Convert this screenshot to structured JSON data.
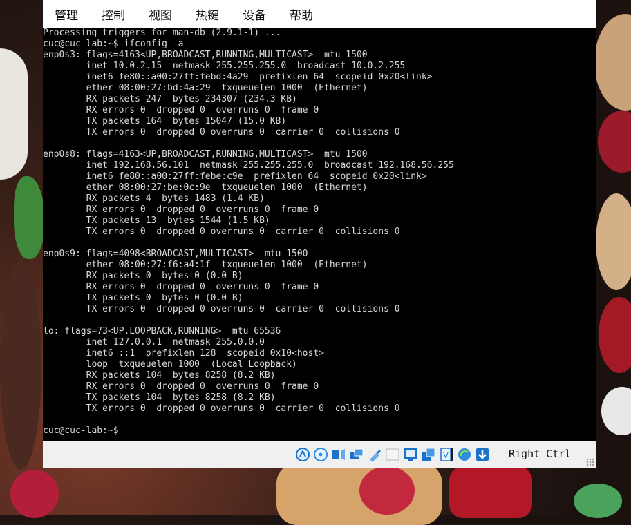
{
  "menubar": {
    "items": [
      "管理",
      "控制",
      "视图",
      "热键",
      "设备",
      "帮助"
    ]
  },
  "terminal": {
    "lines": [
      "Processing triggers for man-db (2.9.1-1) ...",
      "cuc@cuc-lab:~$ ifconfig -a",
      "enp0s3: flags=4163<UP,BROADCAST,RUNNING,MULTICAST>  mtu 1500",
      "        inet 10.0.2.15  netmask 255.255.255.0  broadcast 10.0.2.255",
      "        inet6 fe80::a00:27ff:febd:4a29  prefixlen 64  scopeid 0x20<link>",
      "        ether 08:00:27:bd:4a:29  txqueuelen 1000  (Ethernet)",
      "        RX packets 247  bytes 234307 (234.3 KB)",
      "        RX errors 0  dropped 0  overruns 0  frame 0",
      "        TX packets 164  bytes 15047 (15.0 KB)",
      "        TX errors 0  dropped 0 overruns 0  carrier 0  collisions 0",
      "",
      "enp0s8: flags=4163<UP,BROADCAST,RUNNING,MULTICAST>  mtu 1500",
      "        inet 192.168.56.101  netmask 255.255.255.0  broadcast 192.168.56.255",
      "        inet6 fe80::a00:27ff:febe:c9e  prefixlen 64  scopeid 0x20<link>",
      "        ether 08:00:27:be:0c:9e  txqueuelen 1000  (Ethernet)",
      "        RX packets 4  bytes 1483 (1.4 KB)",
      "        RX errors 0  dropped 0  overruns 0  frame 0",
      "        TX packets 13  bytes 1544 (1.5 KB)",
      "        TX errors 0  dropped 0 overruns 0  carrier 0  collisions 0",
      "",
      "enp0s9: flags=4098<BROADCAST,MULTICAST>  mtu 1500",
      "        ether 08:00:27:f6:a4:1f  txqueuelen 1000  (Ethernet)",
      "        RX packets 0  bytes 0 (0.0 B)",
      "        RX errors 0  dropped 0  overruns 0  frame 0",
      "        TX packets 0  bytes 0 (0.0 B)",
      "        TX errors 0  dropped 0 overruns 0  carrier 0  collisions 0",
      "",
      "lo: flags=73<UP,LOOPBACK,RUNNING>  mtu 65536",
      "        inet 127.0.0.1  netmask 255.0.0.0",
      "        inet6 ::1  prefixlen 128  scopeid 0x10<host>",
      "        loop  txqueuelen 1000  (Local Loopback)",
      "        RX packets 104  bytes 8258 (8.2 KB)",
      "        RX errors 0  dropped 0  overruns 0  frame 0",
      "        TX packets 104  bytes 8258 (8.2 KB)",
      "        TX errors 0  dropped 0 overruns 0  carrier 0  collisions 0",
      "",
      "cuc@cuc-lab:~$"
    ]
  },
  "status_bar": {
    "icons": [
      "hard-disk-icon",
      "optical-drive-icon",
      "audio-icon",
      "network-icon",
      "usb-icon",
      "shared-folder-icon",
      "display-icon",
      "video-capture-icon",
      "virtualization-icon",
      "recording-icon",
      "mouse-integration-icon"
    ],
    "host_key": "Right Ctrl"
  },
  "colors": {
    "terminal_bg": "#000000",
    "terminal_fg": "#d8d8d8",
    "menubar_bg": "#ffffff",
    "statusbar_bg": "#f0f0f0",
    "icon_blue": "#1a73c9"
  }
}
